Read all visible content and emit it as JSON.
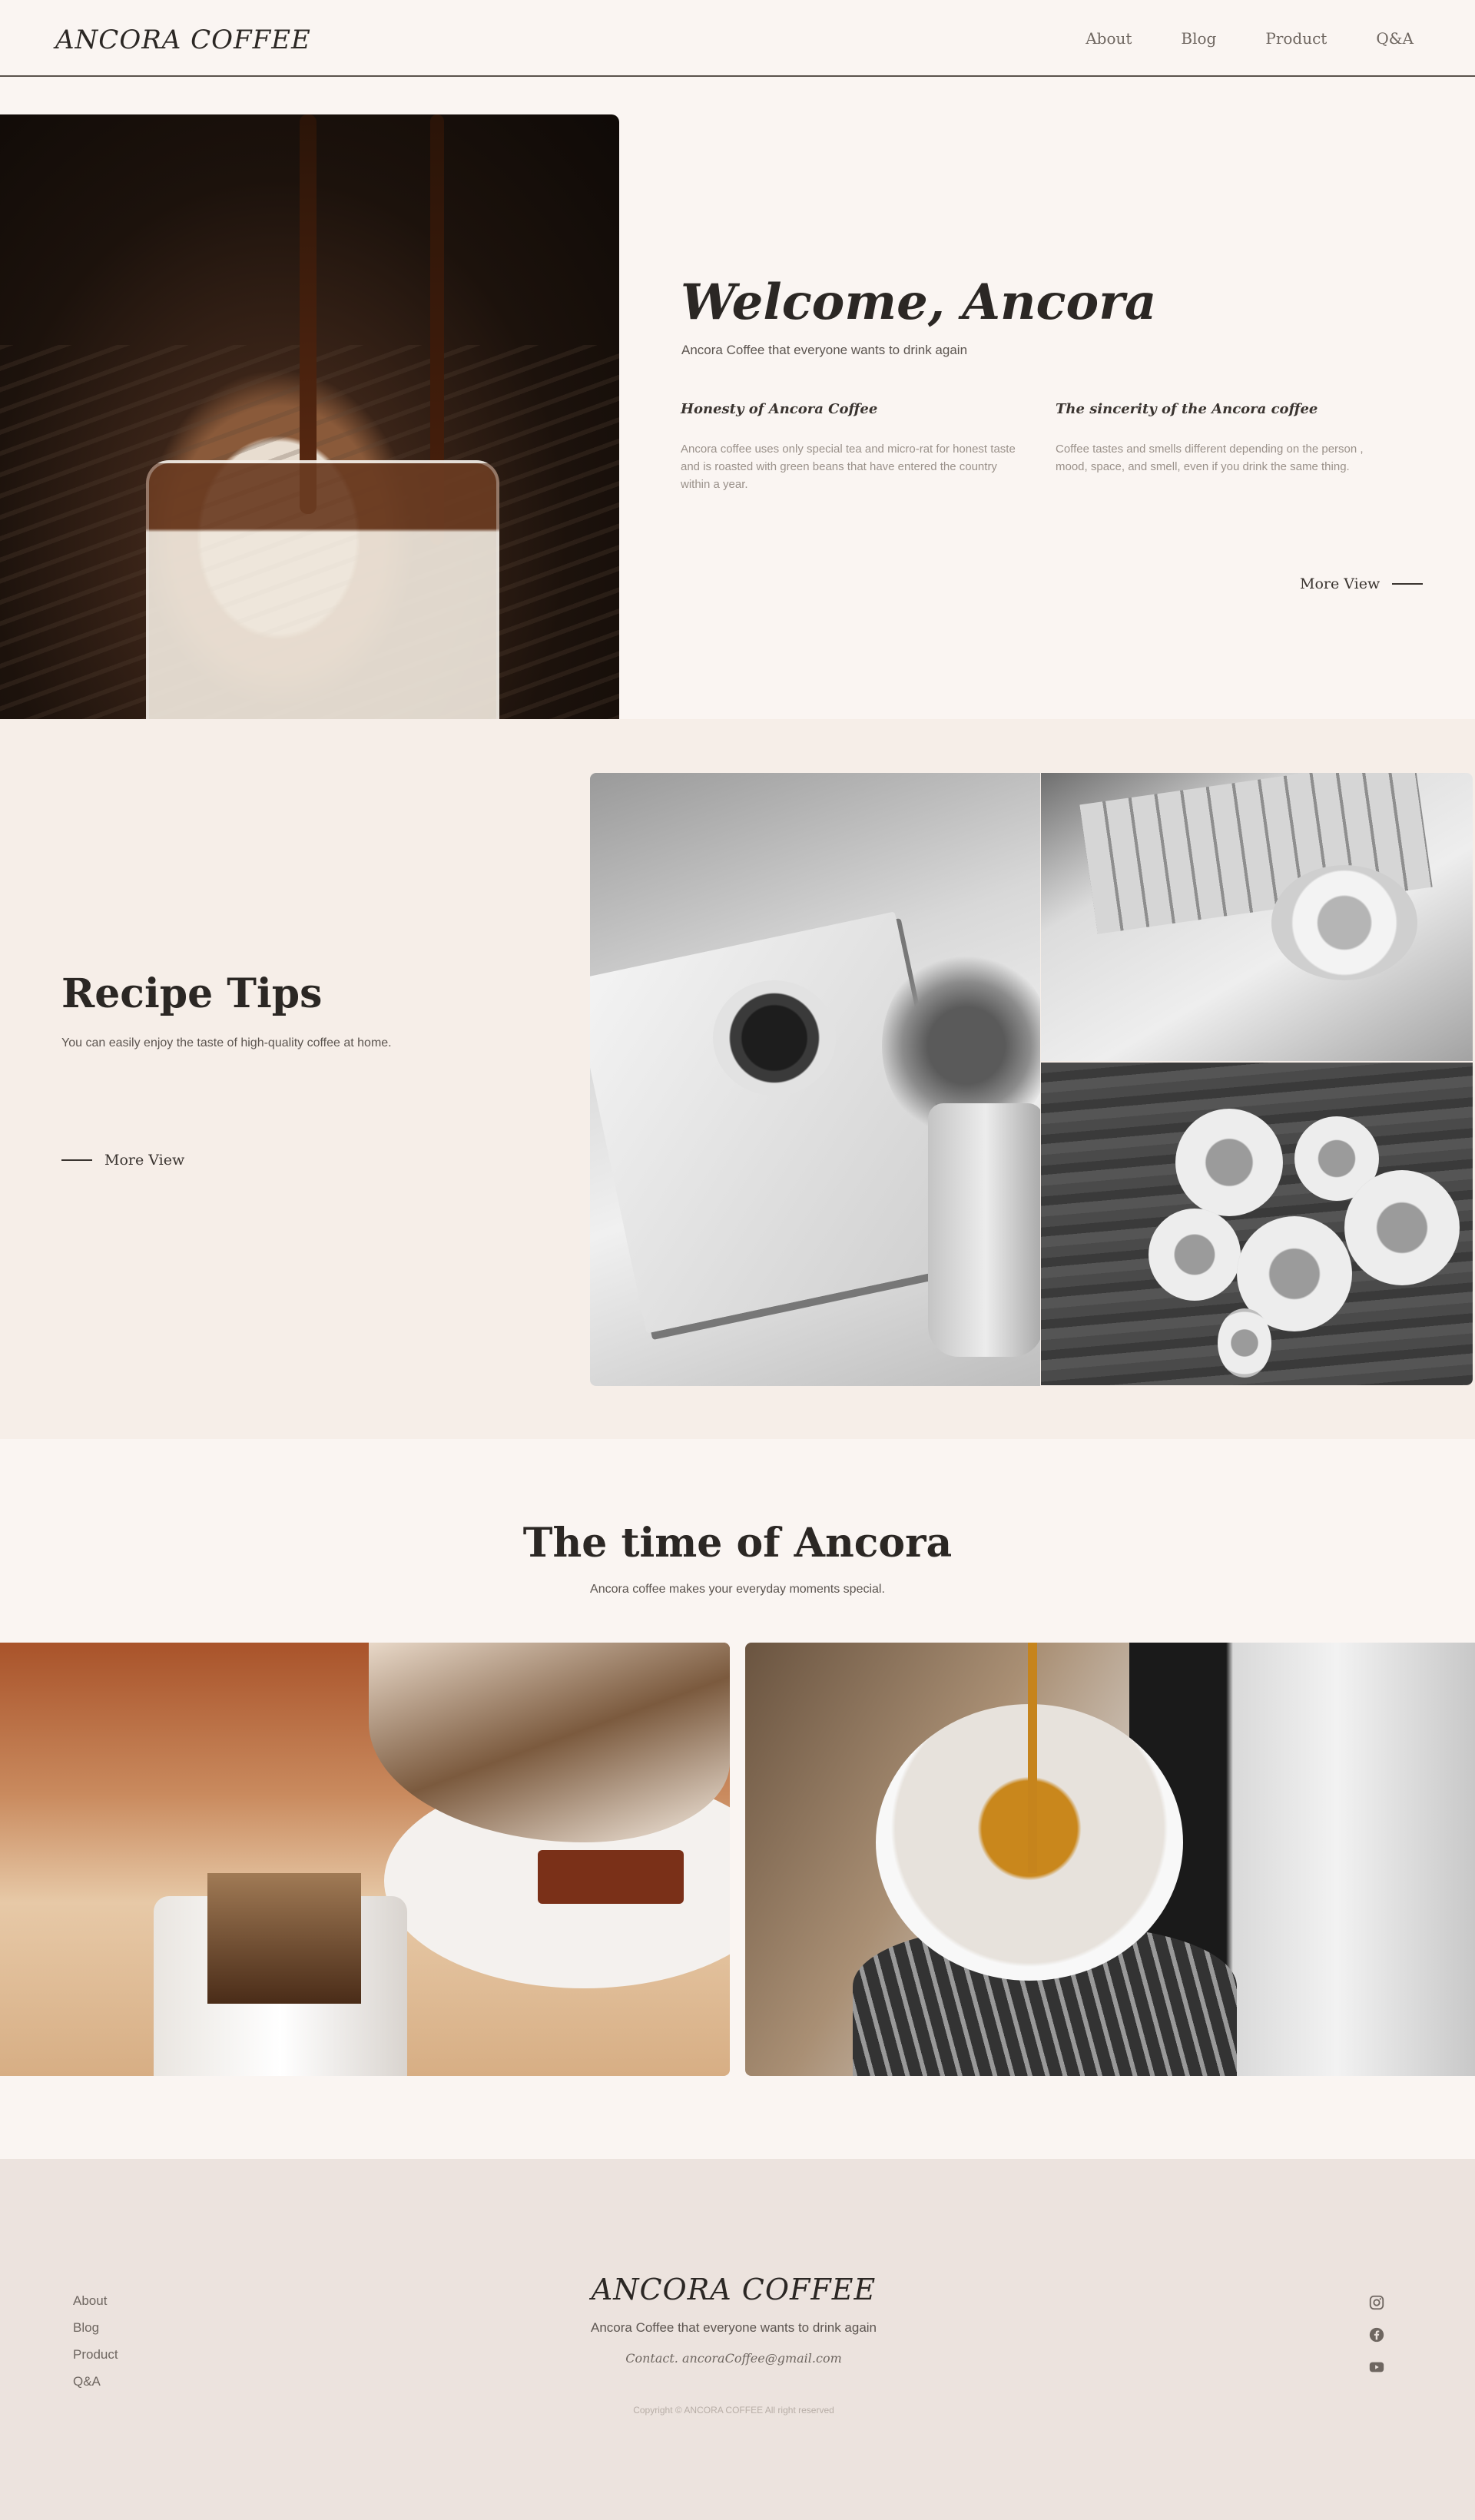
{
  "header": {
    "logo": "ANCORA COFFEE",
    "nav": [
      "About",
      "Blog",
      "Product",
      "Q&A"
    ]
  },
  "hero": {
    "title": "Welcome, Ancora",
    "subtitle": "Ancora Coffee that everyone wants to drink again",
    "columns": [
      {
        "heading": "Honesty of Ancora Coffee",
        "text": "Ancora coffee uses only special tea and micro-rat for honest taste and is roasted with green beans that have entered the country within a year."
      },
      {
        "heading": "The sincerity of the Ancora coffee",
        "text": "Coffee tastes and smells different depending on the person , mood, space, and smell, even if you drink the same thing."
      }
    ],
    "more": "More View"
  },
  "recipe": {
    "title": "Recipe Tips",
    "subtitle": "You can easily enjoy the taste of high-quality coffee at home.",
    "more": "More View"
  },
  "time": {
    "title": "The time of Ancora",
    "subtitle": "Ancora coffee makes your everyday moments special."
  },
  "footer": {
    "links": [
      "About",
      "Blog",
      "Product",
      "Q&A"
    ],
    "logo": "ANCORA COFFEE",
    "tagline": "Ancora Coffee that everyone wants to drink again",
    "contact": "Contact. ancoraCoffee@gmail.com",
    "copyright": "Copyright © ANCORA COFFEE All right reserved",
    "social_icons": [
      "instagram-icon",
      "facebook-icon",
      "youtube-icon"
    ]
  }
}
